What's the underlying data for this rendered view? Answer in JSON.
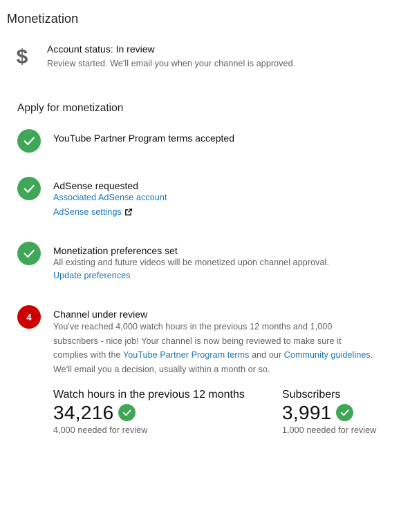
{
  "page": {
    "title": "Monetization"
  },
  "account_status": {
    "icon": "dollar-icon",
    "title": "Account status: In review",
    "subtitle": "Review started. We'll email you when your channel is approved."
  },
  "apply": {
    "title": "Apply for monetization",
    "steps": [
      {
        "title": "YouTube Partner Program terms accepted",
        "icon": "check-circle-icon"
      },
      {
        "title": "AdSense requested",
        "icon": "check-circle-icon",
        "links": [
          "Associated AdSense account",
          "AdSense settings"
        ]
      },
      {
        "title": "Monetization preferences set",
        "icon": "check-circle-icon",
        "desc": "All existing and future videos will be monetized upon channel approval.",
        "link": "Update preferences"
      },
      {
        "number": "4",
        "title": "Channel under review",
        "desc_line1": "You've reached 4,000 watch hours in the previous 12 months and 1,000",
        "desc_line2": "subscribers - nice job! Your channel is now being reviewed to make sure it",
        "desc_line3_pre": "complies with the ",
        "desc_line3_link1": "YouTube Partner Program terms",
        "desc_line3_mid": " and our ",
        "desc_line3_link2": "Community guidelines",
        "desc_line3_post": ".",
        "desc_line4": "We'll email you a decision, usually within a month or so."
      }
    ]
  },
  "metrics": {
    "watch_hours": {
      "label": "Watch hours in the previous 12 months",
      "value": "34,216",
      "note": "4,000 needed for review"
    },
    "subscribers": {
      "label": "Subscribers",
      "value": "3,991",
      "note": "1,000 needed for review"
    }
  },
  "colors": {
    "check_green": "#3fa757",
    "step_red": "#cc0000",
    "link_blue": "#1a73b8"
  }
}
